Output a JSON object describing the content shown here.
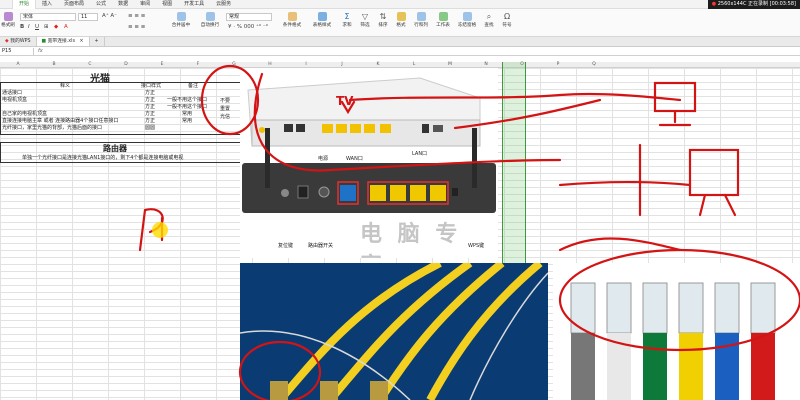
{
  "menubar": {
    "items": [
      "开始",
      "插入",
      "页面布局",
      "公式",
      "数据",
      "审阅",
      "视图",
      "开发工具",
      "云服务"
    ],
    "active_index": 0,
    "recording": "2560x144C 正在录制 [00:03:58]"
  },
  "ribbon": {
    "format_painter": "格式刷",
    "font_name": "宋体",
    "font_size": "11",
    "number_format": "常规",
    "merge_center": "合并居中",
    "wrap_text": "自动换行",
    "conditional_format": "条件格式",
    "table_style": "表格样式",
    "sum": "求和",
    "filter": "筛选",
    "sort": "排序",
    "format": "格式",
    "row_col": "行和列",
    "worksheet": "工作表",
    "freeze": "冻结窗格",
    "find": "查找",
    "symbol": "符号"
  },
  "doctabs": {
    "tabs": [
      "我的WPS",
      "宽带连接.xls"
    ],
    "active_index": 1
  },
  "formula": {
    "namebox": "P15",
    "fx": "fx",
    "value": ""
  },
  "columns": [
    "A",
    "B",
    "C",
    "D",
    "E",
    "F",
    "G",
    "H",
    "I",
    "J",
    "K",
    "L",
    "M",
    "N",
    "O",
    "P",
    "Q"
  ],
  "sheet": {
    "title1": "光猫",
    "header_meaning": "释义",
    "header_port": "接口样式",
    "header_note": "备注",
    "rows1": [
      {
        "name": "通话接口",
        "port": "方正",
        "note": ""
      },
      {
        "name": "电视机顶盒",
        "port": "方正",
        "note": "一般不用这个接口"
      },
      {
        "name": "",
        "port": "方正",
        "note": "一般不用这个接口"
      },
      {
        "name": "自己家的电视机顶盒",
        "port": "方正",
        "note": "常用"
      },
      {
        "name": "直接连接电脑主章 或者 连接路由器4个接口任意接口",
        "port": "方正",
        "note": "常用"
      },
      {
        "name": "光纤接口，家里光猫的背部，光猫后面的接口",
        "port": "圆圆",
        "note": ""
      }
    ],
    "side_notes": [
      "不要",
      "重置",
      "光信"
    ],
    "title2": "路由器",
    "router_note": "单独一个光纤接口是连接光猫LAN1接口的，剩下4个都是连接电脑或电视"
  },
  "router_image": {
    "labels": {
      "power": "电源",
      "wan": "WAN口",
      "lan": "LAN口",
      "reset": "复位键",
      "switch": "路由器开关",
      "wps": "WPS键"
    },
    "watermark": "电 脑 专 家"
  },
  "annotations": {
    "tv": "TV"
  },
  "colors": {
    "accent": "#2a8a2a",
    "annotation": "#d41414",
    "ethernet_blue": "#1e73c8",
    "ethernet_yellow": "#f0c800",
    "selection": "#3b9a3b"
  }
}
